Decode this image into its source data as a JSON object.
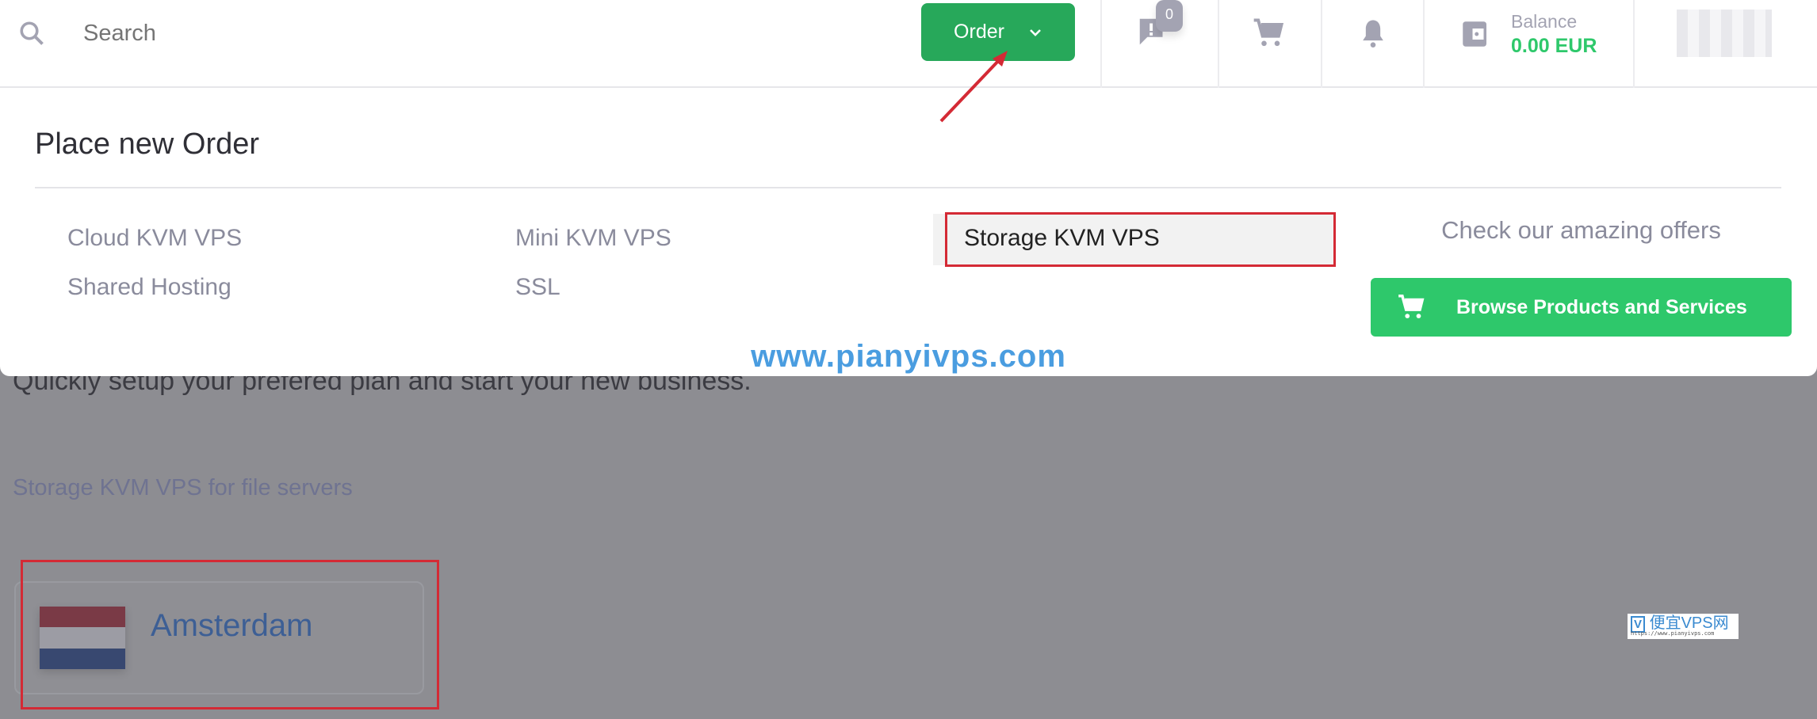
{
  "header": {
    "search_placeholder": "Search",
    "order_label": "Order",
    "notifications_badge": "0",
    "balance_label": "Balance",
    "balance_value": "0.00 EUR",
    "icons": [
      "search-icon",
      "chevron-down-icon",
      "ticket-chat-icon",
      "cart-icon",
      "bell-icon",
      "wallet-icon"
    ]
  },
  "dropdown": {
    "title": "Place new Order",
    "items": [
      "Cloud KVM VPS",
      "Shared Hosting",
      "Mini KVM VPS",
      "SSL",
      "Storage KVM VPS"
    ],
    "offers_text": "Check our amazing offers",
    "browse_label": "Browse Products and Services"
  },
  "watermark": "www.pianyivps.com",
  "page": {
    "subtitle": "Quickly setup your prefered plan and start your new business.",
    "section_title": "Storage KVM VPS for file servers",
    "location": "Amsterdam"
  },
  "logo": {
    "main": "便宜VPS网",
    "url": "https://www.pianyivps.com"
  },
  "colors": {
    "green": "#27a85a",
    "browse_green": "#2ec86b",
    "highlight_red": "#d42a35",
    "balance_green": "#2ec86b"
  }
}
